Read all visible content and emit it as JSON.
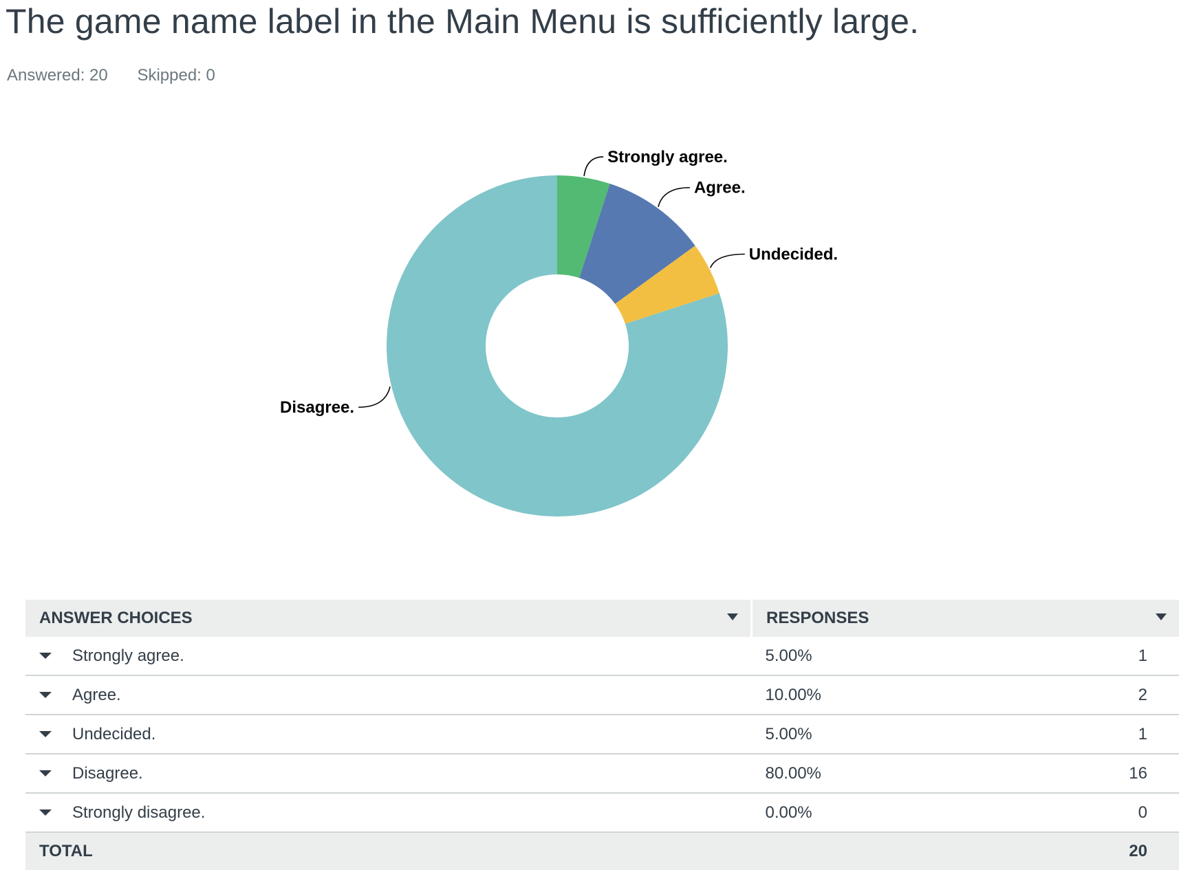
{
  "question": {
    "title": "The game name label in the Main Menu is sufficiently large.",
    "answered": "Answered: 20",
    "skipped": "Skipped: 0"
  },
  "chart_data": {
    "type": "pie",
    "donut": true,
    "categories": [
      "Strongly agree.",
      "Agree.",
      "Undecided.",
      "Disagree.",
      "Strongly disagree."
    ],
    "values": [
      5,
      10,
      5,
      80,
      0
    ],
    "colors": [
      "#53ba74",
      "#5779b1",
      "#f3bf43",
      "#80c5ca",
      "#999999"
    ],
    "title": "",
    "labels": [
      "Strongly agree.",
      "Agree.",
      "Undecided.",
      "Disagree."
    ]
  },
  "table": {
    "headers": {
      "choices": "ANSWER CHOICES",
      "responses": "RESPONSES"
    },
    "rows": [
      {
        "choice": "Strongly agree.",
        "percent": "5.00%",
        "count": "1"
      },
      {
        "choice": "Agree.",
        "percent": "10.00%",
        "count": "2"
      },
      {
        "choice": "Undecided.",
        "percent": "5.00%",
        "count": "1"
      },
      {
        "choice": "Disagree.",
        "percent": "80.00%",
        "count": "16"
      },
      {
        "choice": "Strongly disagree.",
        "percent": "0.00%",
        "count": "0"
      }
    ],
    "total_label": "TOTAL",
    "total_value": "20"
  }
}
